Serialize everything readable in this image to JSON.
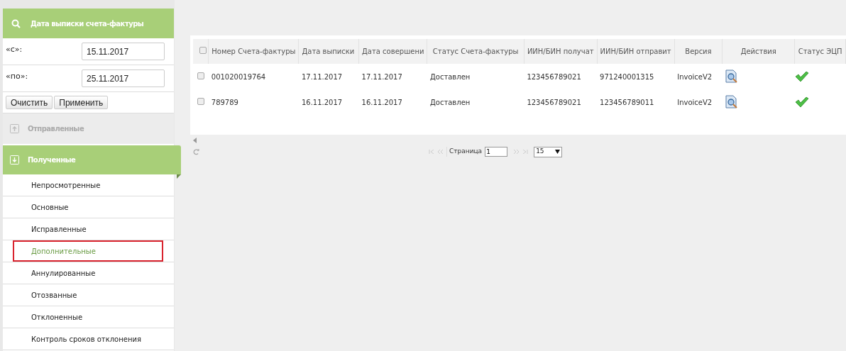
{
  "filter": {
    "title": "Дата выписки счета-фактуры",
    "fields": [
      {
        "label": "«с»:",
        "value": "15.11.2017"
      },
      {
        "label": "«по»:",
        "value": "25.11.2017"
      }
    ],
    "buttons": [
      "Очистить",
      "Применить"
    ]
  },
  "sections": [
    {
      "kind": "sent",
      "label": "Отправленные",
      "selected": false
    },
    {
      "kind": "received",
      "label": "Полученные",
      "selected": true
    }
  ],
  "subitems": [
    {
      "label": "Непросмотренные",
      "selected": false
    },
    {
      "label": "Основные",
      "selected": false
    },
    {
      "label": "Исправленные",
      "selected": false
    },
    {
      "label": "Дополнительные",
      "selected": true
    },
    {
      "label": "Аннулированные",
      "selected": false
    },
    {
      "label": "Отозванные",
      "selected": false
    },
    {
      "label": "Отклоненные",
      "selected": false
    },
    {
      "label": "Контроль сроков отклонения",
      "selected": false
    }
  ],
  "table": {
    "select_all_checked": false,
    "columns": [
      "Номер Счета-фактуры",
      "Дата выписки",
      "Дата совершени",
      "Статус Счета-фактуры",
      "ИИН/БИН получат",
      "ИИН/БИН отправит",
      "Версия",
      "Действия",
      "Статус ЭЦП"
    ],
    "rows": [
      {
        "checked": false,
        "cells": [
          "001020019764",
          "17.11.2017",
          "17.11.2017",
          "Доставлен",
          "123456789021",
          "971240001315",
          "InvoiceV2"
        ],
        "signature_valid": true
      },
      {
        "checked": false,
        "cells": [
          "789789",
          "16.11.2017",
          "16.11.2017",
          "Доставлен",
          "123456789021",
          "123456789011",
          "InvoiceV2"
        ],
        "signature_valid": true
      }
    ]
  },
  "pager": {
    "page_label": "Страница",
    "page": "1",
    "page_size": "15"
  }
}
